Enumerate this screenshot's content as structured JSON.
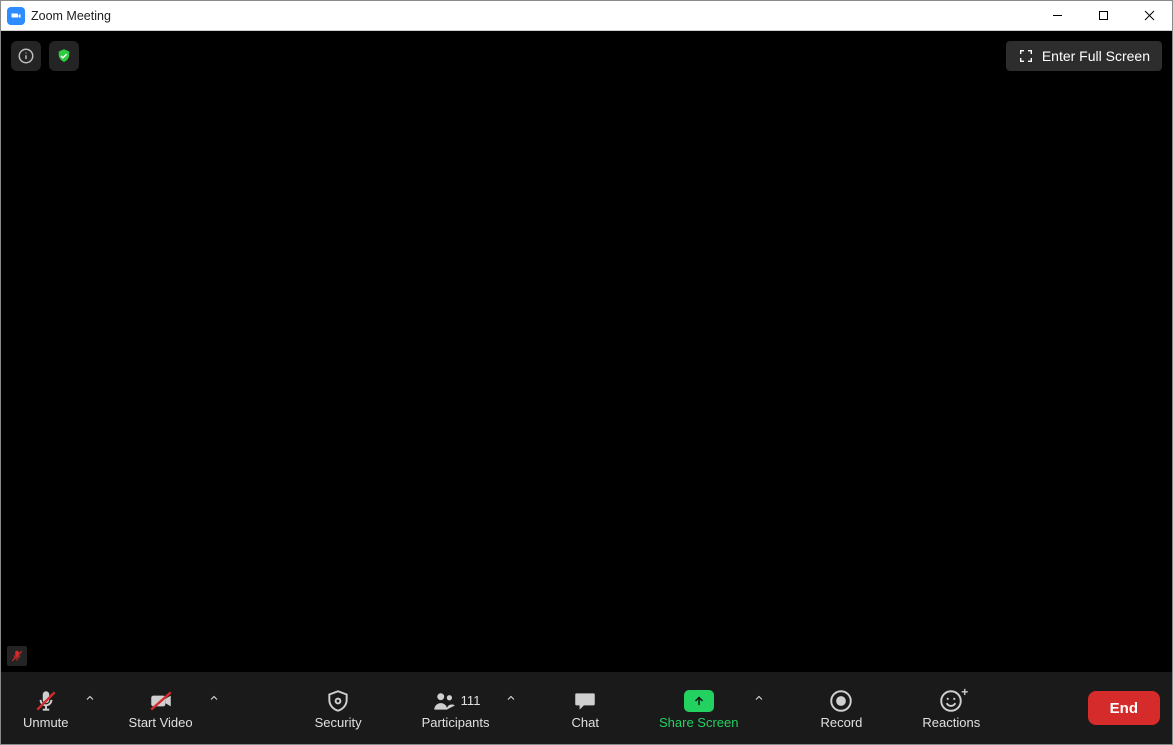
{
  "window": {
    "title": "Zoom Meeting"
  },
  "top": {
    "fullscreen_label": "Enter Full Screen"
  },
  "toolbar": {
    "unmute": "Unmute",
    "start_video": "Start Video",
    "security": "Security",
    "participants": "Participants",
    "participants_count": "111",
    "chat": "Chat",
    "share_screen": "Share Screen",
    "record": "Record",
    "reactions": "Reactions",
    "end": "End"
  }
}
